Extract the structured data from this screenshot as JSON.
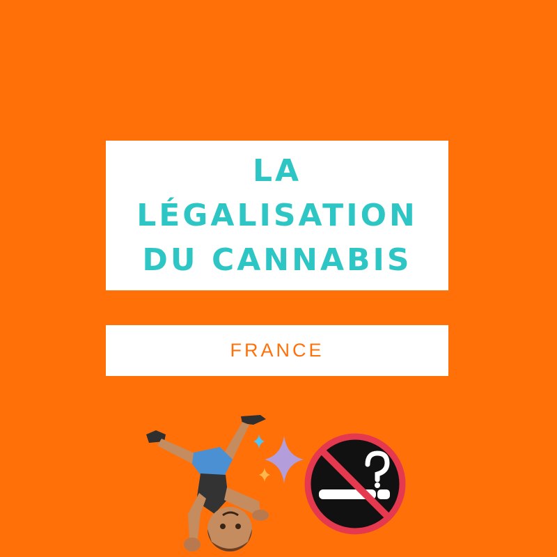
{
  "title": {
    "lines": [
      "LA",
      "LÉGALISATION",
      "DU CANNABIS"
    ]
  },
  "subtitle": "FRANCE",
  "colors": {
    "background": "#ff7009",
    "title_text": "#2ec6c4",
    "subtitle_text": "#ff7009",
    "box": "#ffffff"
  },
  "icons": [
    "person-cartwheeling-icon",
    "sparkles-icon",
    "no-smoking-icon"
  ]
}
